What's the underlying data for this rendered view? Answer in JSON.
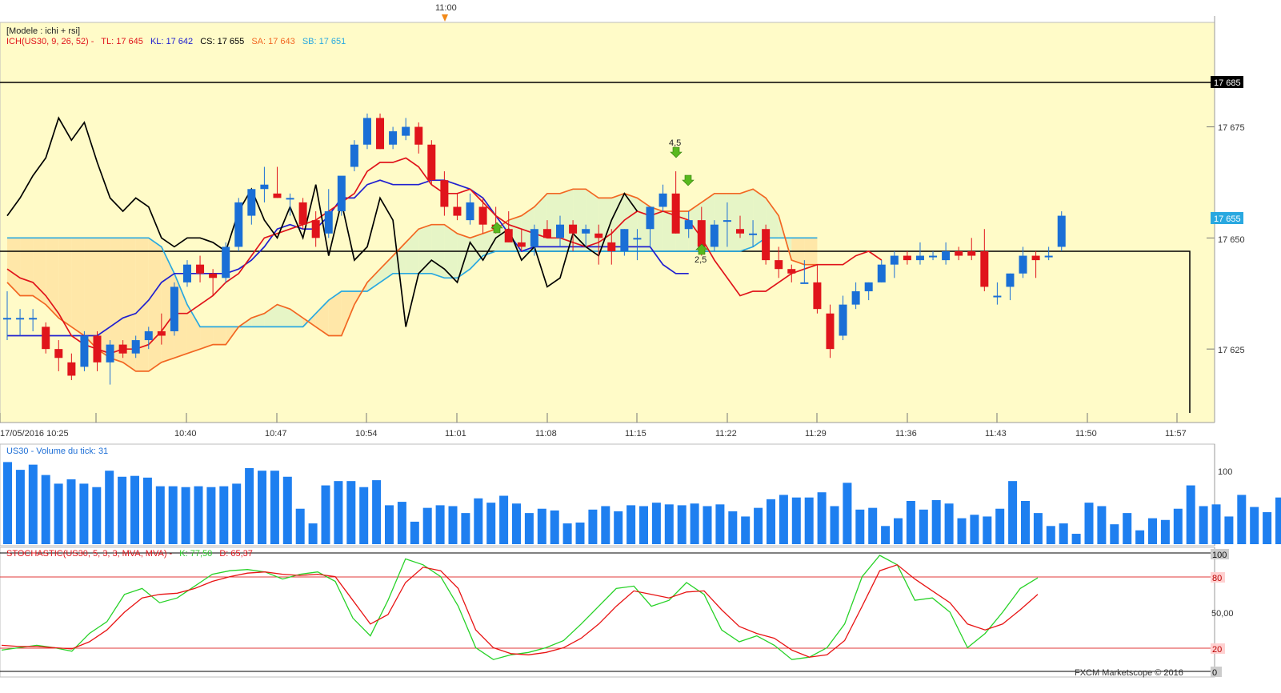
{
  "header": {
    "top_time_label": "11:00",
    "model_label": "[Modele : ichi + rsi]",
    "ichimoku_params": "ICH(US30, 9, 26, 52) -",
    "tl_label": "TL: 17 645",
    "kl_label": "KL: 17 642",
    "cs_label": "CS: 17 655",
    "sa_label": "SA: 17 643",
    "sb_label": "SB: 17 651"
  },
  "price_axis": {
    "ticks": [
      "17 675",
      "17 650",
      "17 625"
    ],
    "box_upper": "17 685",
    "box_current": "17 655"
  },
  "time_axis": {
    "labels": [
      "17/05/2016 10:25",
      "10:40",
      "10:47",
      "10:54",
      "11:01",
      "11:08",
      "11:15",
      "11:22",
      "11:29",
      "11:36",
      "11:43",
      "11:50",
      "11:57"
    ]
  },
  "annotations": {
    "up_label": "4,5",
    "down_label": "2,5"
  },
  "volume_panel": {
    "title": "US30 - Volume du tick: 31",
    "axis_label": "100"
  },
  "stochastic_panel": {
    "title": "STOCHASTIC(US30, 5, 3, 3, MVA, MVA) -",
    "k_label": "K: 77,50",
    "d_label": "D: 65,37",
    "axis_labels": [
      "100",
      "80",
      "50,00",
      "20",
      "0"
    ]
  },
  "footer": {
    "copyright": "FXCM Marketscope © 2016"
  },
  "colors": {
    "bull": "#1a6fd6",
    "bear": "#e0141b",
    "tenkan": "#e0141b",
    "kijun": "#2020d0",
    "chikou": "#000000",
    "senkou_a": "#f26722",
    "senkou_b": "#29a8e0",
    "volume": "#1e7ff0",
    "stoch_k": "#28d228",
    "stoch_d": "#e81414",
    "plot_bg": "#fffbc8",
    "cloud_green": "#e6f5c6",
    "cloud_orange": "#ffe7a8"
  },
  "chart_data": {
    "type": "candlestick",
    "symbol": "US30",
    "date": "17/05/2016",
    "ylim": [
      17610,
      17700
    ],
    "horizontal_lines": [
      17685,
      17647
    ],
    "candles": [
      {
        "o": 17632,
        "h": 17638,
        "l": 17627,
        "c": 17632
      },
      {
        "o": 17632,
        "h": 17634,
        "l": 17628,
        "c": 17632
      },
      {
        "o": 17632,
        "h": 17634,
        "l": 17629,
        "c": 17632
      },
      {
        "o": 17630,
        "h": 17631,
        "l": 17624,
        "c": 17625
      },
      {
        "o": 17625,
        "h": 17627,
        "l": 17620,
        "c": 17623
      },
      {
        "o": 17622,
        "h": 17624,
        "l": 17618,
        "c": 17619
      },
      {
        "o": 17621,
        "h": 17629,
        "l": 17620,
        "c": 17628
      },
      {
        "o": 17628,
        "h": 17629,
        "l": 17620,
        "c": 17622
      },
      {
        "o": 17622,
        "h": 17627,
        "l": 17617,
        "c": 17626
      },
      {
        "o": 17626,
        "h": 17627,
        "l": 17623,
        "c": 17624
      },
      {
        "o": 17624,
        "h": 17628,
        "l": 17623,
        "c": 17627
      },
      {
        "o": 17627,
        "h": 17630,
        "l": 17625,
        "c": 17629
      },
      {
        "o": 17629,
        "h": 17633,
        "l": 17626,
        "c": 17628
      },
      {
        "o": 17629,
        "h": 17640,
        "l": 17628,
        "c": 17639
      },
      {
        "o": 17640,
        "h": 17645,
        "l": 17639,
        "c": 17644
      },
      {
        "o": 17644,
        "h": 17646,
        "l": 17640,
        "c": 17642
      },
      {
        "o": 17642,
        "h": 17643,
        "l": 17637,
        "c": 17641
      },
      {
        "o": 17641,
        "h": 17649,
        "l": 17640,
        "c": 17648
      },
      {
        "o": 17648,
        "h": 17659,
        "l": 17647,
        "c": 17658
      },
      {
        "o": 17655,
        "h": 17660,
        "l": 17653,
        "c": 17661
      },
      {
        "o": 17661,
        "h": 17666,
        "l": 17658,
        "c": 17662
      },
      {
        "o": 17660,
        "h": 17666,
        "l": 17659,
        "c": 17659
      },
      {
        "o": 17659,
        "h": 17660,
        "l": 17655,
        "c": 17659
      },
      {
        "o": 17658,
        "h": 17659,
        "l": 17652,
        "c": 17653
      },
      {
        "o": 17654,
        "h": 17656,
        "l": 17648,
        "c": 17650
      },
      {
        "o": 17651,
        "h": 17661,
        "l": 17650,
        "c": 17656
      },
      {
        "o": 17656,
        "h": 17662,
        "l": 17655,
        "c": 17664
      },
      {
        "o": 17666,
        "h": 17672,
        "l": 17665,
        "c": 17671
      },
      {
        "o": 17671,
        "h": 17678,
        "l": 17670,
        "c": 17677
      },
      {
        "o": 17677,
        "h": 17678,
        "l": 17670,
        "c": 17670
      },
      {
        "o": 17671,
        "h": 17675,
        "l": 17670,
        "c": 17674
      },
      {
        "o": 17673,
        "h": 17677,
        "l": 17672,
        "c": 17675
      },
      {
        "o": 17675,
        "h": 17676,
        "l": 17669,
        "c": 17671
      },
      {
        "o": 17671,
        "h": 17672,
        "l": 17662,
        "c": 17663
      },
      {
        "o": 17663,
        "h": 17665,
        "l": 17655,
        "c": 17657
      },
      {
        "o": 17657,
        "h": 17660,
        "l": 17654,
        "c": 17655
      },
      {
        "o": 17654,
        "h": 17660,
        "l": 17653,
        "c": 17658
      },
      {
        "o": 17657,
        "h": 17659,
        "l": 17651,
        "c": 17653
      },
      {
        "o": 17653,
        "h": 17657,
        "l": 17651,
        "c": 17652
      },
      {
        "o": 17652,
        "h": 17656,
        "l": 17649,
        "c": 17649
      },
      {
        "o": 17649,
        "h": 17652,
        "l": 17647,
        "c": 17648
      },
      {
        "o": 17648,
        "h": 17653,
        "l": 17646,
        "c": 17652
      },
      {
        "o": 17652,
        "h": 17654,
        "l": 17650,
        "c": 17650
      },
      {
        "o": 17650,
        "h": 17655,
        "l": 17648,
        "c": 17653
      },
      {
        "o": 17653,
        "h": 17654,
        "l": 17647,
        "c": 17651
      },
      {
        "o": 17651,
        "h": 17653,
        "l": 17648,
        "c": 17652
      },
      {
        "o": 17651,
        "h": 17653,
        "l": 17644,
        "c": 17650
      },
      {
        "o": 17649,
        "h": 17652,
        "l": 17644,
        "c": 17647
      },
      {
        "o": 17647,
        "h": 17652,
        "l": 17646,
        "c": 17652
      },
      {
        "o": 17650,
        "h": 17652,
        "l": 17645,
        "c": 17650
      },
      {
        "o": 17652,
        "h": 17656,
        "l": 17648,
        "c": 17657
      },
      {
        "o": 17657,
        "h": 17662,
        "l": 17656,
        "c": 17660
      },
      {
        "o": 17660,
        "h": 17665,
        "l": 17651,
        "c": 17651
      },
      {
        "o": 17652,
        "h": 17656,
        "l": 17650,
        "c": 17654
      },
      {
        "o": 17654,
        "h": 17657,
        "l": 17646,
        "c": 17648
      },
      {
        "o": 17648,
        "h": 17654,
        "l": 17647,
        "c": 17653
      },
      {
        "o": 17654,
        "h": 17658,
        "l": 17648,
        "c": 17654
      },
      {
        "o": 17652,
        "h": 17655,
        "l": 17650,
        "c": 17651
      },
      {
        "o": 17651,
        "h": 17654,
        "l": 17648,
        "c": 17651
      },
      {
        "o": 17652,
        "h": 17653,
        "l": 17644,
        "c": 17645
      },
      {
        "o": 17645,
        "h": 17648,
        "l": 17641,
        "c": 17643
      },
      {
        "o": 17643,
        "h": 17644,
        "l": 17640,
        "c": 17642
      },
      {
        "o": 17640,
        "h": 17645,
        "l": 17640,
        "c": 17640
      },
      {
        "o": 17640,
        "h": 17644,
        "l": 17633,
        "c": 17634
      },
      {
        "o": 17633,
        "h": 17635,
        "l": 17623,
        "c": 17625
      },
      {
        "o": 17628,
        "h": 17637,
        "l": 17627,
        "c": 17635
      },
      {
        "o": 17635,
        "h": 17640,
        "l": 17634,
        "c": 17638
      },
      {
        "o": 17638,
        "h": 17640,
        "l": 17636,
        "c": 17640
      },
      {
        "o": 17640,
        "h": 17645,
        "l": 17640,
        "c": 17644
      },
      {
        "o": 17644,
        "h": 17647,
        "l": 17641,
        "c": 17646
      },
      {
        "o": 17646,
        "h": 17647,
        "l": 17644,
        "c": 17645
      },
      {
        "o": 17645,
        "h": 17649,
        "l": 17644,
        "c": 17646
      },
      {
        "o": 17646,
        "h": 17647,
        "l": 17645,
        "c": 17646
      },
      {
        "o": 17645,
        "h": 17649,
        "l": 17644,
        "c": 17647
      },
      {
        "o": 17647,
        "h": 17648,
        "l": 17645,
        "c": 17646
      },
      {
        "o": 17647,
        "h": 17650,
        "l": 17645,
        "c": 17646
      },
      {
        "o": 17647,
        "h": 17652,
        "l": 17638,
        "c": 17639
      },
      {
        "o": 17637,
        "h": 17640,
        "l": 17635,
        "c": 17637
      },
      {
        "o": 17639,
        "h": 17642,
        "l": 17636,
        "c": 17642
      },
      {
        "o": 17642,
        "h": 17648,
        "l": 17641,
        "c": 17646
      },
      {
        "o": 17646,
        "h": 17647,
        "l": 17641,
        "c": 17645
      },
      {
        "o": 17646,
        "h": 17648,
        "l": 17645,
        "c": 17646
      },
      {
        "o": 17648,
        "h": 17656,
        "l": 17647,
        "c": 17655
      }
    ],
    "volume": [
      95,
      86,
      92,
      80,
      70,
      75,
      70,
      66,
      85,
      78,
      79,
      77,
      67,
      67,
      66,
      67,
      66,
      67,
      70,
      88,
      85,
      85,
      78,
      41,
      24,
      68,
      73,
      73,
      66,
      74,
      45,
      49,
      26,
      42,
      45,
      44,
      36,
      53,
      48,
      56,
      47,
      36,
      41,
      39,
      24,
      25,
      40,
      44,
      38,
      45,
      44,
      48,
      46,
      45,
      47,
      44,
      46,
      38,
      32,
      42,
      52,
      57,
      54,
      54,
      60,
      44,
      71,
      40,
      42,
      21,
      30,
      50,
      40,
      51,
      47,
      30,
      34,
      32,
      41,
      73,
      50,
      36,
      21,
      24,
      12,
      48,
      44,
      23,
      36,
      16,
      30,
      28,
      41,
      68,
      44,
      46,
      32,
      57,
      43,
      37,
      54,
      12,
      13,
      38,
      38,
      43,
      56,
      19,
      20,
      17,
      39,
      16,
      17,
      41,
      36,
      49,
      68,
      25,
      23,
      36,
      16,
      10
    ],
    "tenkan": [
      17643,
      17641,
      17640,
      17637,
      17633,
      17628,
      17626,
      17625,
      17624,
      17625,
      17625,
      17626,
      17629,
      17633,
      17633,
      17635,
      17637,
      17640,
      17642,
      17646,
      17650,
      17651,
      17652,
      17653,
      17654,
      17656,
      17658,
      17660,
      17665,
      17667,
      17667,
      17668,
      17666,
      17662,
      17660,
      17660,
      17661,
      17658,
      17655,
      17653,
      17652,
      17651,
      17650,
      17650,
      17649,
      17648,
      17649,
      17651,
      17654,
      17656,
      17655,
      17656,
      17655,
      17654,
      17650,
      17645,
      17641,
      17637,
      17638,
      17638,
      17640,
      17642,
      17643,
      17644,
      17644,
      17644,
      17646,
      17647,
      17645
    ],
    "kijun": [
      17628,
      17628,
      17628,
      17628,
      17628,
      17628,
      17628,
      17628,
      17630,
      17632,
      17633,
      17636,
      17640,
      17642,
      17642,
      17642,
      17642,
      17642,
      17643,
      17645,
      17648,
      17652,
      17653,
      17652,
      17652,
      17655,
      17659,
      17659,
      17662,
      17663,
      17662,
      17662,
      17662,
      17663,
      17663,
      17662,
      17661,
      17659,
      17655,
      17651,
      17647,
      17648,
      17648,
      17648,
      17648,
      17648,
      17648,
      17648,
      17648,
      17648,
      17648,
      17644,
      17642,
      17642
    ],
    "chikou": [
      17655,
      17659,
      17664,
      17668,
      17677,
      17672,
      17676,
      17667,
      17659,
      17656,
      17659,
      17657,
      17650,
      17648,
      17650,
      17650,
      17649,
      17647,
      17656,
      17661,
      17654,
      17650,
      17657,
      17650,
      17662,
      17646,
      17658,
      17645,
      17648,
      17659,
      17654,
      17630,
      17642,
      17645,
      17643,
      17640,
      17649,
      17645,
      17650,
      17652,
      17645,
      17648,
      17639,
      17641,
      17651,
      17648,
      17646,
      17654,
      17660,
      17656
    ],
    "senkou_a": [
      17640,
      17637,
      17637,
      17635,
      17632,
      17630,
      17628,
      17625,
      17623,
      17622,
      17620,
      17620,
      17622,
      17623,
      17624,
      17625,
      17626,
      17626,
      17630,
      17632,
      17633,
      17635,
      17634,
      17632,
      17630,
      17628,
      17628,
      17635,
      17640,
      17643,
      17646,
      17649,
      17652,
      17653,
      17653,
      17651,
      17650,
      17651,
      17652,
      17654,
      17655,
      17657,
      17660,
      17660,
      17661,
      17661,
      17659,
      17659,
      17660,
      17659,
      17657,
      17656,
      17656,
      17656,
      17658,
      17660,
      17660,
      17660,
      17661,
      17659,
      17655,
      17645,
      17644,
      17644
    ],
    "senkou_b": [
      17650,
      17650,
      17650,
      17650,
      17650,
      17650,
      17650,
      17650,
      17650,
      17650,
      17650,
      17650,
      17648,
      17642,
      17635,
      17630,
      17630,
      17630,
      17630,
      17630,
      17630,
      17630,
      17630,
      17630,
      17633,
      17636,
      17638,
      17638,
      17638,
      17640,
      17642,
      17642,
      17642,
      17642,
      17641,
      17641,
      17643,
      17646,
      17647,
      17647,
      17647,
      17647,
      17647,
      17647,
      17647,
      17647,
      17647,
      17647,
      17647,
      17647,
      17647,
      17647,
      17647,
      17647,
      17647,
      17647,
      17647,
      17647,
      17648,
      17650,
      17650,
      17650,
      17650,
      17650
    ],
    "stochastic": {
      "k": [
        18,
        20,
        22,
        20,
        17,
        32,
        42,
        65,
        70,
        58,
        62,
        72,
        82,
        85,
        86,
        84,
        78,
        82,
        84,
        76,
        45,
        30,
        60,
        95,
        90,
        80,
        55,
        20,
        10,
        14,
        16,
        20,
        26,
        40,
        55,
        70,
        72,
        55,
        60,
        75,
        65,
        35,
        25,
        30,
        22,
        10,
        12,
        20,
        40,
        80,
        98,
        90,
        60,
        62,
        50,
        20,
        32,
        50,
        70,
        79
      ],
      "d": [
        22,
        21,
        21,
        20,
        19,
        25,
        35,
        50,
        62,
        65,
        66,
        70,
        76,
        80,
        83,
        84,
        82,
        81,
        82,
        80,
        60,
        40,
        48,
        75,
        88,
        85,
        70,
        35,
        20,
        15,
        14,
        16,
        20,
        28,
        40,
        55,
        68,
        65,
        62,
        67,
        68,
        52,
        38,
        32,
        28,
        18,
        12,
        14,
        26,
        55,
        85,
        90,
        78,
        68,
        58,
        40,
        35,
        40,
        52,
        65
      ],
      "levels": [
        80,
        20
      ],
      "ylim": [
        0,
        100
      ]
    }
  }
}
